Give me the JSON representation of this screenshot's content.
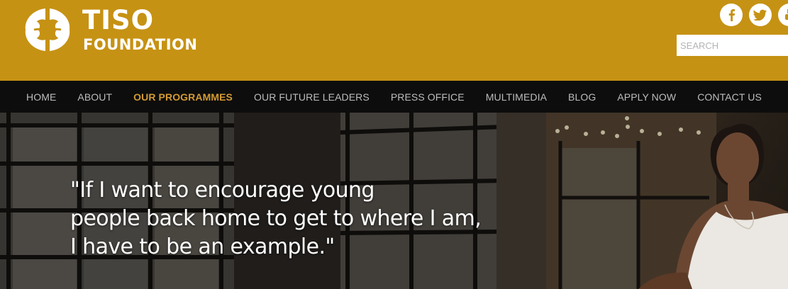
{
  "header": {
    "logo_title": "TISO",
    "logo_subtitle": "FOUNDATION",
    "brand_color": "#c69214",
    "social": [
      "facebook-icon",
      "twitter-icon",
      "youtube-icon"
    ],
    "search": {
      "placeholder": "SEARCH"
    }
  },
  "nav": {
    "items": [
      {
        "label": "HOME"
      },
      {
        "label": "ABOUT"
      },
      {
        "label": "OUR PROGRAMMES",
        "active": true
      },
      {
        "label": "OUR FUTURE LEADERS"
      },
      {
        "label": "PRESS OFFICE"
      },
      {
        "label": "MULTIMEDIA"
      },
      {
        "label": "BLOG"
      },
      {
        "label": "APPLY NOW"
      },
      {
        "label": "CONTACT US"
      }
    ],
    "active_color": "#d39a34"
  },
  "hero": {
    "quote_lines": [
      "\"If I want to encourage young",
      "people back home to get to where I am,",
      "I have to be an example.\""
    ]
  }
}
